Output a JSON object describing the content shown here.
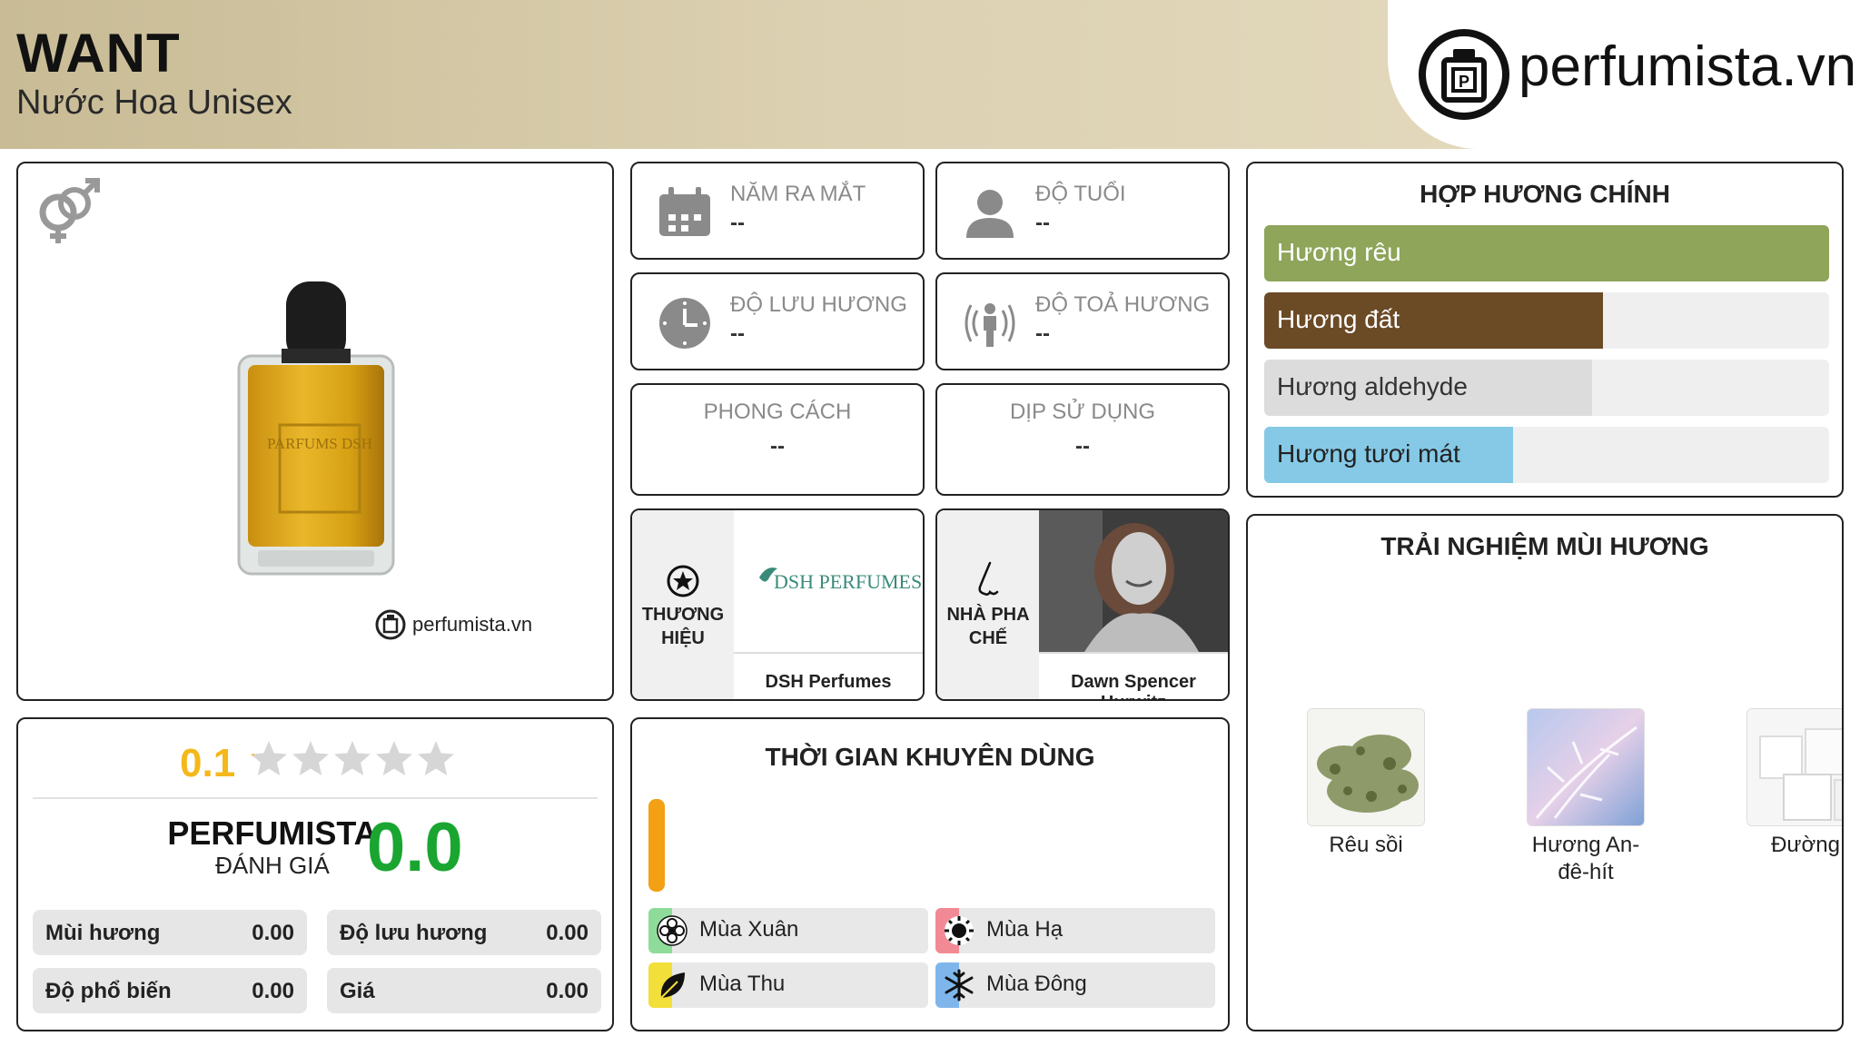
{
  "header": {
    "title": "WANT",
    "subtitle": "Nước Hoa Unisex",
    "logo_text": "perfumista.vn"
  },
  "product": {
    "watermark": "perfumista.vn",
    "bottle_label": "PARFUMS DSH"
  },
  "info": {
    "launch_year": {
      "title": "NĂM RA MẮT",
      "value": "--"
    },
    "age": {
      "title": "ĐỘ TUỔI",
      "value": "--"
    },
    "longevity": {
      "title": "ĐỘ LƯU HƯƠNG",
      "value": "--"
    },
    "sillage": {
      "title": "ĐỘ TOẢ HƯƠNG",
      "value": "--"
    },
    "style": {
      "title": "PHONG CÁCH",
      "value": "--"
    },
    "occasion": {
      "title": "DỊP SỬ DỤNG",
      "value": "--"
    }
  },
  "brand": {
    "label_line1": "THƯƠNG",
    "label_line2": "HIỆU",
    "logo_text": "DSH PERFUMES",
    "name": "DSH Perfumes"
  },
  "perfumer": {
    "label_line1": "NHÀ PHA",
    "label_line2": "CHẾ",
    "name": "Dawn Spencer Hurwitz"
  },
  "accords": {
    "title": "HỢP HƯƠNG CHÍNH",
    "items": [
      {
        "label": "Hương rêu",
        "percent": 100,
        "color": "#8ea55a",
        "label_color": "#ffffff"
      },
      {
        "label": "Hương đất",
        "percent": 60,
        "color": "#6b4a26",
        "label_color": "#ffffff"
      },
      {
        "label": "Hương aldehyde",
        "percent": 58,
        "color": "#dcdcdc",
        "label_color": "#333333"
      },
      {
        "label": "Hương tươi mát",
        "percent": 44,
        "color": "#85c9e6",
        "label_color": "#222222"
      }
    ]
  },
  "experience": {
    "title": "TRẢI NGHIỆM MÙI HƯƠNG",
    "notes": [
      {
        "name_line1": "Rêu sồi",
        "name_line2": "",
        "icon": "oakmoss-image"
      },
      {
        "name_line1": "Hương An-",
        "name_line2": "đê-hít",
        "icon": "aldehyde-image"
      },
      {
        "name_line1": "Đường",
        "name_line2": "",
        "icon": "sugar-image"
      }
    ]
  },
  "rating": {
    "user_score": "0.1",
    "stars": 0.1,
    "brand_line1": "PERFUMISTA",
    "brand_line2": "ĐÁNH GIÁ",
    "perfumista_score": "0.0",
    "scores": [
      {
        "label": "Mùi hương",
        "value": "0.00"
      },
      {
        "label": "Độ lưu hương",
        "value": "0.00"
      },
      {
        "label": "Độ phổ biến",
        "value": "0.00"
      },
      {
        "label": "Giá",
        "value": "0.00"
      }
    ]
  },
  "usage": {
    "title": "THỜI GIAN KHUYÊN DÙNG",
    "seasons": [
      {
        "label": "Mùa Xuân",
        "color": "#8fdc9a",
        "icon": "flower-icon"
      },
      {
        "label": "Mùa Hạ",
        "color": "#f18a95",
        "icon": "sun-icon"
      },
      {
        "label": "Mùa Thu",
        "color": "#f3df3a",
        "icon": "leaf-icon"
      },
      {
        "label": "Mùa Đông",
        "color": "#7eb6ec",
        "icon": "snowflake-icon"
      }
    ]
  },
  "colors": {
    "accent_yellow": "#f5b81c",
    "green_score": "#1aa531",
    "time_bar": "#f3a014"
  }
}
